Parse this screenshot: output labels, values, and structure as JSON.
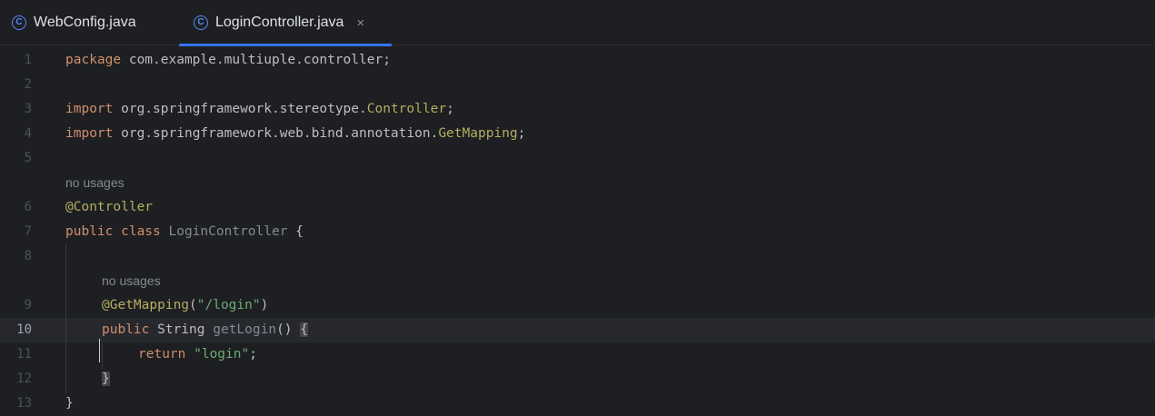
{
  "tabs": [
    {
      "label": "WebConfig.java",
      "icon": "class-icon",
      "active": false
    },
    {
      "label": "LoginController.java",
      "icon": "class-icon",
      "active": true,
      "close": "×"
    }
  ],
  "icon_glyph": "C",
  "colors": {
    "keyword": "#cf8e6d",
    "annotation": "#b3ae60",
    "string": "#6aab73",
    "accent": "#3574f0",
    "background": "#1e1f22"
  },
  "editor": {
    "line_numbers": [
      "1",
      "2",
      "3",
      "4",
      "5",
      "6",
      "7",
      "8",
      "9",
      "10",
      "11",
      "12",
      "13"
    ],
    "current_line": "10",
    "hints": [
      "no usages",
      "no usages"
    ],
    "code": {
      "l1_kw": "package",
      "l1_rest": " com.example.multiuple.controller;",
      "l3_kw": "import",
      "l3_pkg": " org.springframework.stereotype.",
      "l3_cls": "Controller",
      "l3_end": ";",
      "l4_kw": "import",
      "l4_pkg": " org.springframework.web.bind.annotation.",
      "l4_cls": "GetMapping",
      "l4_end": ";",
      "l6_ann": "@Controller",
      "l7_kw": "public class",
      "l7_name": " LoginController",
      "l7_end": " {",
      "l9_ann": "@GetMapping",
      "l9_open": "(",
      "l9_str": "\"/login\"",
      "l9_close": ")",
      "l10_kw": "public",
      "l10_type": " String",
      "l10_name": " getLogin",
      "l10_paren": "() ",
      "l10_brace": "{",
      "l11_kw": "return",
      "l11_str": " \"login\"",
      "l11_end": ";",
      "l12_brace": "}",
      "l13_brace": "}"
    }
  }
}
